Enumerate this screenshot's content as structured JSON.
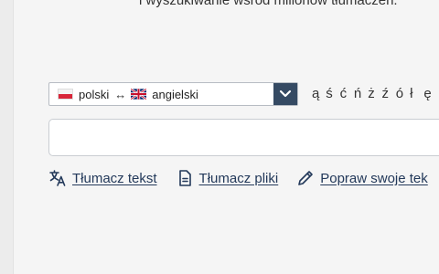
{
  "tagline": "i wyszukiwanie wśród milionów tłumaczeń.",
  "language_selector": {
    "source_lang": "polski",
    "target_lang": "angielski",
    "swap_symbol": "↔"
  },
  "special_chars": [
    "ą",
    "ś",
    "ć",
    "ń",
    "ż",
    "ź",
    "ó",
    "ł",
    "ę"
  ],
  "search": {
    "value": "",
    "placeholder": ""
  },
  "actions": [
    {
      "label": "Tłumacz tekst",
      "icon": "translate-icon"
    },
    {
      "label": "Tłumacz pliki",
      "icon": "document-icon"
    },
    {
      "label": "Popraw swoje tek",
      "icon": "pencil-icon"
    }
  ],
  "colors": {
    "select_button": "#354a63",
    "link": "#23395a"
  }
}
